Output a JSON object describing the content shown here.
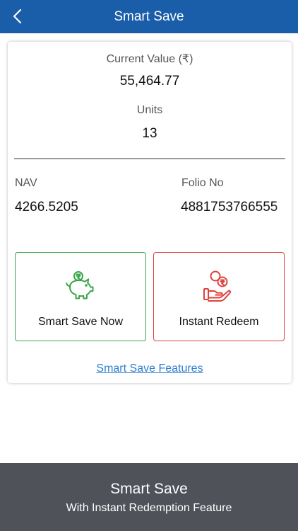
{
  "header": {
    "title": "Smart Save",
    "back_icon": "chevron-left-icon",
    "color": "#1a5ea9"
  },
  "summary": {
    "current_value_label": "Current Value (₹)",
    "current_value": "55,464.77",
    "units_label": "Units",
    "units": "13"
  },
  "details": {
    "nav_label": "NAV",
    "nav_value": "4266.5205",
    "folio_label": "Folio No",
    "folio_value": "4881753766555"
  },
  "actions": {
    "save": {
      "label": "Smart Save Now",
      "icon": "piggy-bank-icon",
      "color": "#3aa648"
    },
    "redeem": {
      "label": "Instant Redeem",
      "icon": "hand-coins-icon",
      "color": "#e0413e"
    }
  },
  "features_link": "Smart Save Features",
  "footer": {
    "title": "Smart Save",
    "subtitle": "With Instant Redemption Feature",
    "color": "#4f5359"
  }
}
